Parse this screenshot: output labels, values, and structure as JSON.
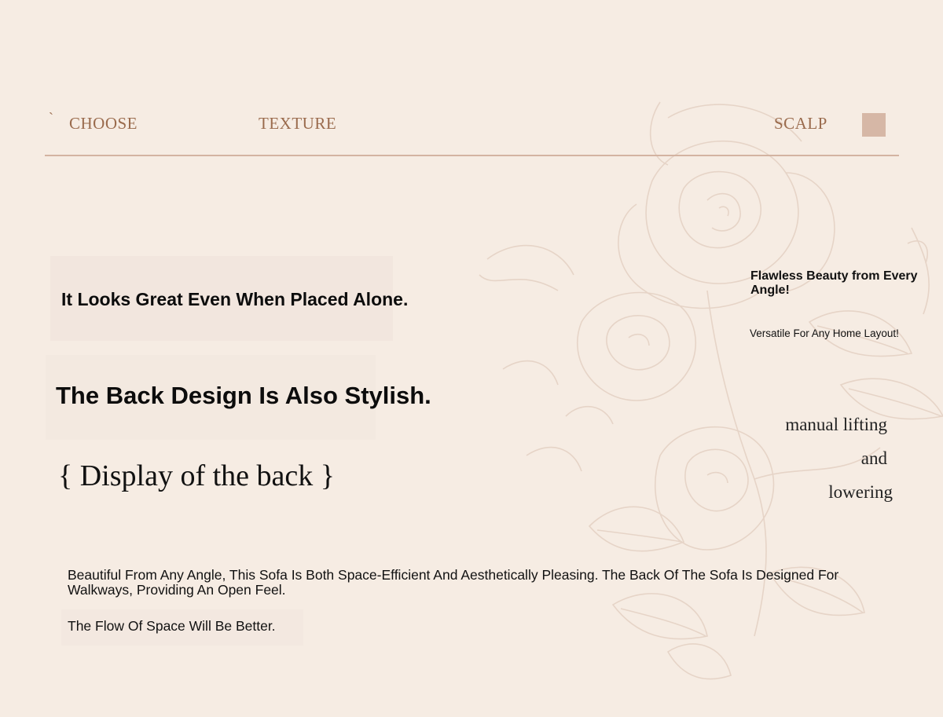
{
  "nav": {
    "tick": "`",
    "choose": "CHOOSE",
    "texture": "TEXTURE",
    "scalp": "SCALP"
  },
  "colors": {
    "background": "#f6ece3",
    "nav_text": "#9a6b4d",
    "nav_square": "#d6b7a6",
    "rule": "#d3b3a1"
  },
  "icons": {
    "nav_square": "square-icon",
    "background_art": "rose-line-art"
  },
  "main": {
    "headline_alone": "It Looks Great Even When Placed Alone.",
    "headline_back": "The Back Design Is Also Stylish.",
    "display_back": "{ Display of the back }",
    "description": "Beautiful From Any Angle, This Sofa Is Both Space-Efficient And Aesthetically Pleasing. The Back Of The Sofa Is Designed For Walkways, Providing An Open Feel.",
    "flow": "The Flow Of Space Will Be Better."
  },
  "side": {
    "title": "Flawless Beauty from Every Angle!",
    "subtitle": "Versatile For Any Home Layout!",
    "lift_line_1": "manual lifting",
    "lift_line_2": "and",
    "lift_line_3": "lowering"
  }
}
